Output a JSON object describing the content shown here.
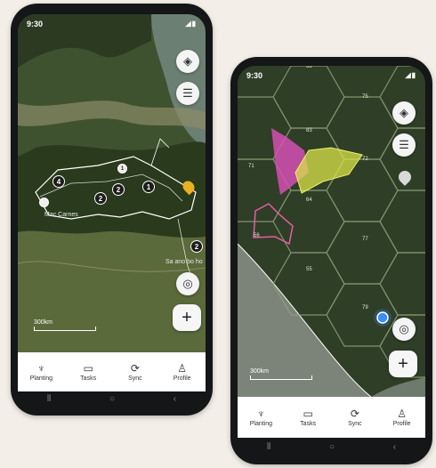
{
  "left_phone": {
    "status": {
      "time": "9:30",
      "signal": "◢▮"
    },
    "map": {
      "scale_label": "300km",
      "place_labels": [
        "Mac Carnes",
        "Sa ano bo ho"
      ],
      "cluster_counts": [
        "4",
        "2",
        "2",
        "1",
        "1",
        "2"
      ]
    },
    "nav": [
      {
        "label": "Planting",
        "icon": "tree-icon"
      },
      {
        "label": "Tasks",
        "icon": "clipboard-icon"
      },
      {
        "label": "Sync",
        "icon": "sync-icon"
      },
      {
        "label": "Profile",
        "icon": "person-icon"
      }
    ],
    "add_label": "+"
  },
  "right_phone": {
    "status": {
      "time": "9:30",
      "signal": "◢▮"
    },
    "map": {
      "scale_label": "300km",
      "hex_numbers": [
        "53",
        "83",
        "75",
        "72",
        "64",
        "77",
        "55",
        "79",
        "71",
        "56"
      ]
    },
    "nav": [
      {
        "label": "Planting",
        "icon": "tree-icon"
      },
      {
        "label": "Tasks",
        "icon": "clipboard-icon"
      },
      {
        "label": "Sync",
        "icon": "sync-icon"
      },
      {
        "label": "Profile",
        "icon": "person-icon"
      }
    ],
    "add_label": "+"
  },
  "colors": {
    "polygon_magenta": "#d54fb4",
    "polygon_yellow": "#d9e34a",
    "polygon_pink_outline": "#e65fa2",
    "location_dot": "#3a8dff",
    "pin_yellow": "#e8b21f"
  }
}
